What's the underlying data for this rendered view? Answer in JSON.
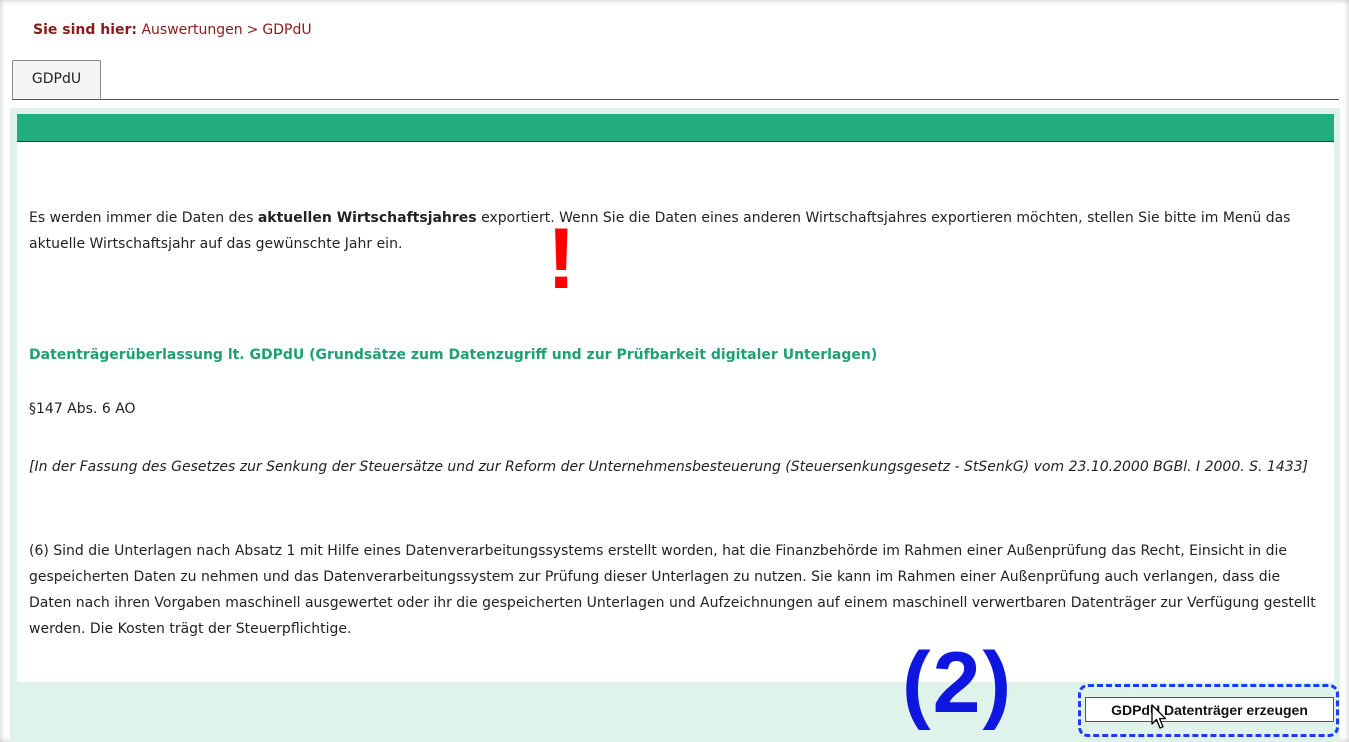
{
  "breadcrumb": {
    "lead": "Sie sind hier:",
    "section": "Auswertungen",
    "separator": ">",
    "current": "GDPdU"
  },
  "tabs": [
    {
      "label": "GDPdU",
      "active": true
    }
  ],
  "content": {
    "intro_part1": "Es werden immer die Daten des ",
    "intro_bold": "aktuellen Wirtschaftsjahres",
    "intro_part2": " exportiert. Wenn Sie die Daten eines anderen Wirtschaftsjahres exportieren möchten, stellen Sie bitte im Menü das aktuelle Wirtschaftsjahr auf das gewünschte Jahr ein.",
    "heading": "Datenträgerüberlassung lt. GDPdU (Grundsätze zum Datenzugriff und zur Prüfbarkeit digitaler Unterlagen)",
    "paragraph_ref": "§147 Abs. 6 AO",
    "italic_note": "[In der Fassung des Gesetzes zur Senkung der Steuersätze und zur Reform der Unternehmensbesteuerung (Steuersenkungsgesetz - StSenkG) vom 23.10.2000 BGBl. I 2000. S. 1433]",
    "law_text": "(6) Sind die Unterlagen nach Absatz 1 mit Hilfe eines Datenverarbeitungssystems erstellt worden, hat die Finanzbehörde im Rahmen einer Außenprüfung das Recht, Einsicht in die gespeicherten Daten zu nehmen und das Datenverarbeitungssystem zur Prüfung dieser Unterlagen zu nutzen. Sie kann im Rahmen einer Außenprüfung auch verlangen, dass die Daten nach ihren Vorgaben maschinell ausgewertet oder ihr die gespeicherten Unterlagen und Aufzeichnungen auf einem maschinell verwertbaren Datenträger zur Verfügung gestellt werden. Die Kosten trägt der Steuerpflichtige."
  },
  "annotations": {
    "exclamation": "!",
    "step_marker": "(2)"
  },
  "actions": {
    "create_button_label": "GDPdU Datenträger erzeugen"
  },
  "colors": {
    "accent_green": "#21ad7e",
    "heading_green": "#1fa071",
    "panel_bg": "#dff3ea",
    "breadcrumb_red": "#8b1a1a",
    "annotation_red": "#ff0000",
    "annotation_blue": "#0f16e0"
  },
  "icons": {
    "cursor": "mouse-pointer-icon"
  }
}
